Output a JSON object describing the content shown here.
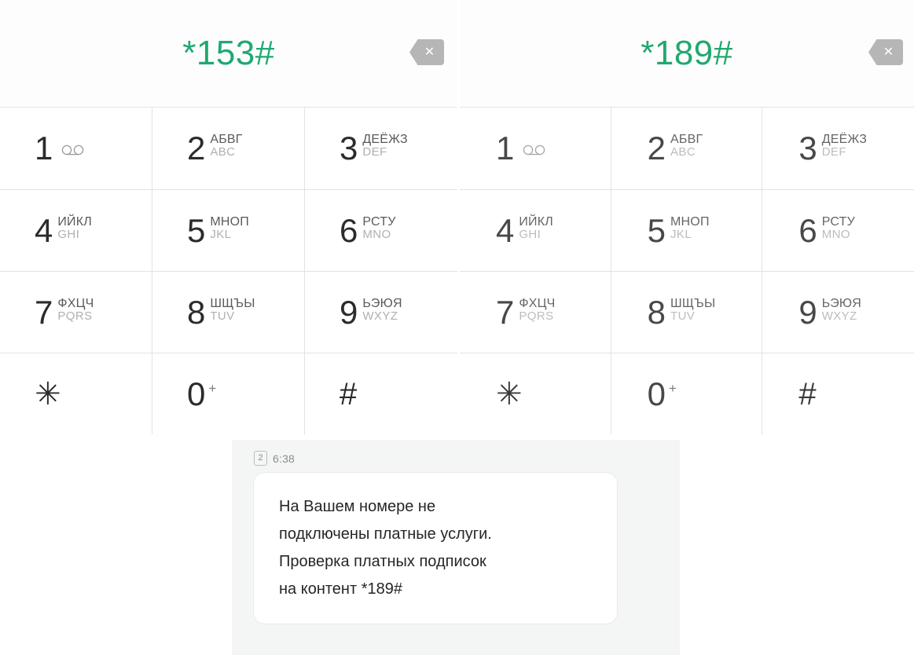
{
  "theme": {
    "accent_green": "#1fa971",
    "key_digit_color": "#2b2b2b",
    "cyrillic_letters_color": "#5a5a5a",
    "latin_letters_color": "#b0b0b0",
    "divider_color": "#e2e2e2",
    "sms_panel_bg": "#f4f5f5",
    "bubble_bg": "#ffffff",
    "backspace_bg": "#b6b6b6"
  },
  "panels": [
    {
      "id": "dialer-left",
      "ussd_code": "*153#",
      "backspace_icon": "backspace-delete-icon",
      "backspace_glyph": "✕"
    },
    {
      "id": "dialer-right",
      "ussd_code": "*189#",
      "backspace_icon": "backspace-delete-icon",
      "backspace_glyph": "✕"
    }
  ],
  "keypad": {
    "keys": [
      {
        "digit": "1",
        "cyrillic": "",
        "latin": "",
        "icon": "voicemail-icon"
      },
      {
        "digit": "2",
        "cyrillic": "АБВГ",
        "latin": "ABC",
        "icon": ""
      },
      {
        "digit": "3",
        "cyrillic": "ДЕЁЖЗ",
        "latin": "DEF",
        "icon": ""
      },
      {
        "digit": "4",
        "cyrillic": "ИЙКЛ",
        "latin": "GHI",
        "icon": ""
      },
      {
        "digit": "5",
        "cyrillic": "МНОП",
        "latin": "JKL",
        "icon": ""
      },
      {
        "digit": "6",
        "cyrillic": "РСТУ",
        "latin": "MNO",
        "icon": ""
      },
      {
        "digit": "7",
        "cyrillic": "ФХЦЧ",
        "latin": "PQRS",
        "icon": ""
      },
      {
        "digit": "8",
        "cyrillic": "ШЩЪЫ",
        "latin": "TUV",
        "icon": ""
      },
      {
        "digit": "9",
        "cyrillic": "ЬЭЮЯ",
        "latin": "WXYZ",
        "icon": ""
      },
      {
        "digit": "✳",
        "cyrillic": "",
        "latin": "",
        "icon": "asterisk-key"
      },
      {
        "digit": "0",
        "cyrillic": "",
        "latin": "",
        "icon": "plus-modifier",
        "superscript": "+"
      },
      {
        "digit": "#",
        "cyrillic": "",
        "latin": "",
        "icon": "hash-key"
      }
    ]
  },
  "sms": {
    "sim_badge": "2",
    "time": "6:38",
    "lines": [
      "На Вашем номере не",
      "подключены платные услуги.",
      "Проверка платных подписок",
      "на контент *189#"
    ],
    "body": "На Вашем номере не подключены платные услуги. Проверка платных подписок на контент *189#"
  }
}
